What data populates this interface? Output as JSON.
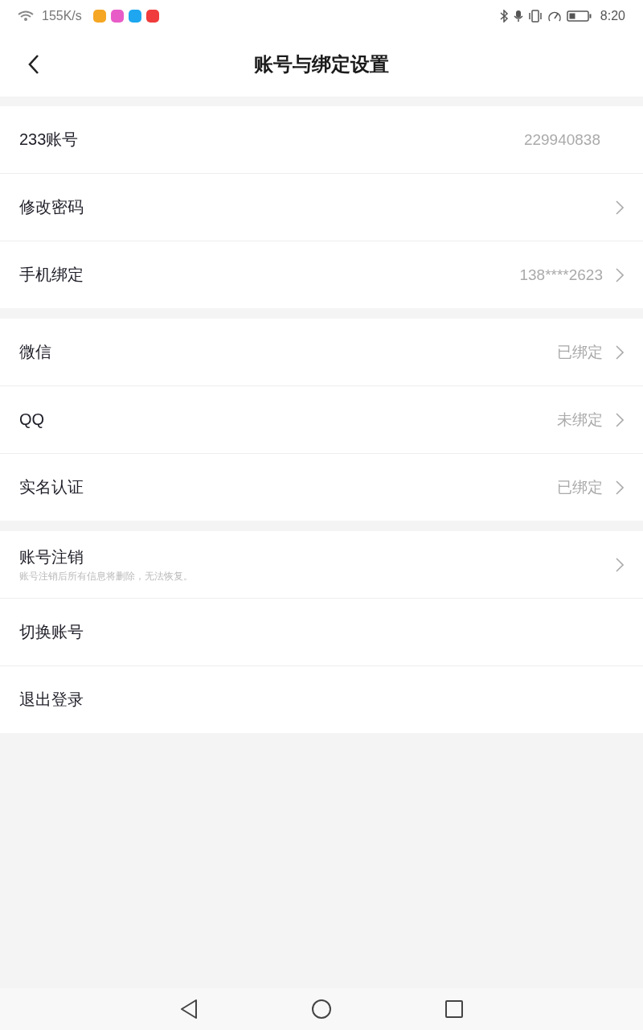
{
  "status_bar": {
    "speed": "155K/s",
    "app_icons": [
      {
        "color": "#f5a623"
      },
      {
        "color": "#e85cc8"
      },
      {
        "color": "#1ea7f0"
      },
      {
        "color": "#f03c3c"
      }
    ],
    "time": "8:20"
  },
  "header": {
    "title": "账号与绑定设置"
  },
  "groups": [
    {
      "rows": [
        {
          "label": "233账号",
          "value": "229940838",
          "chevron": false
        },
        {
          "label": "修改密码",
          "chevron": true
        },
        {
          "label": "手机绑定",
          "value": "138****2623",
          "chevron": true
        }
      ]
    },
    {
      "rows": [
        {
          "label": "微信",
          "value": "已绑定",
          "chevron": true
        },
        {
          "label": "QQ",
          "value": "未绑定",
          "chevron": true
        },
        {
          "label": "实名认证",
          "value": "已绑定",
          "chevron": true
        }
      ]
    },
    {
      "rows": [
        {
          "label": "账号注销",
          "note": "账号注销后所有信息将删除，无法恢复。",
          "chevron": true
        },
        {
          "label": "切换账号",
          "chevron": false
        },
        {
          "label": "退出登录",
          "chevron": false
        }
      ]
    }
  ]
}
